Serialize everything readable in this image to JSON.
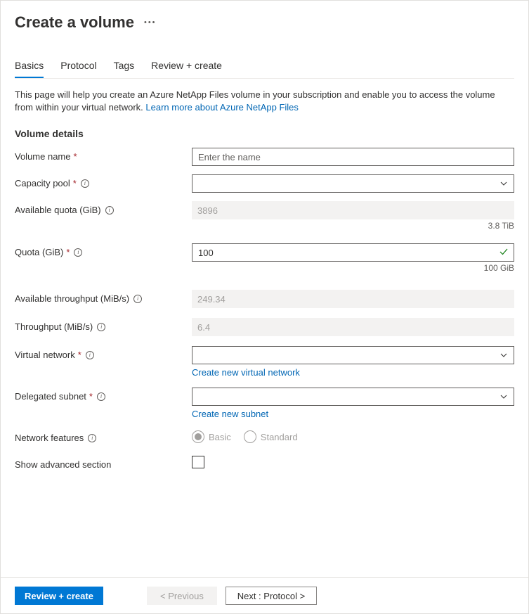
{
  "header": {
    "title": "Create a volume"
  },
  "tabs": {
    "basics": "Basics",
    "protocol": "Protocol",
    "tags": "Tags",
    "review": "Review + create"
  },
  "description": {
    "text": "This page will help you create an Azure NetApp Files volume in your subscription and enable you to access the volume from within your virtual network.  ",
    "link": "Learn more about Azure NetApp Files"
  },
  "section": {
    "volume_details": "Volume details"
  },
  "form": {
    "volume_name": {
      "label": "Volume name",
      "placeholder": "Enter the name",
      "value": ""
    },
    "capacity_pool": {
      "label": "Capacity pool",
      "value": ""
    },
    "available_quota": {
      "label": "Available quota (GiB)",
      "value": "3896",
      "sub": "3.8 TiB"
    },
    "quota": {
      "label": "Quota (GiB)",
      "value": "100",
      "sub": "100 GiB"
    },
    "available_throughput": {
      "label": "Available throughput (MiB/s)",
      "value": "249.34"
    },
    "throughput": {
      "label": "Throughput (MiB/s)",
      "value": "6.4"
    },
    "virtual_network": {
      "label": "Virtual network",
      "value": "",
      "create_link": "Create new virtual network"
    },
    "delegated_subnet": {
      "label": "Delegated subnet",
      "value": "",
      "create_link": "Create new subnet"
    },
    "network_features": {
      "label": "Network features",
      "basic": "Basic",
      "standard": "Standard"
    },
    "show_advanced": {
      "label": "Show advanced section"
    }
  },
  "footer": {
    "review": "Review + create",
    "previous": "< Previous",
    "next": "Next : Protocol >"
  }
}
